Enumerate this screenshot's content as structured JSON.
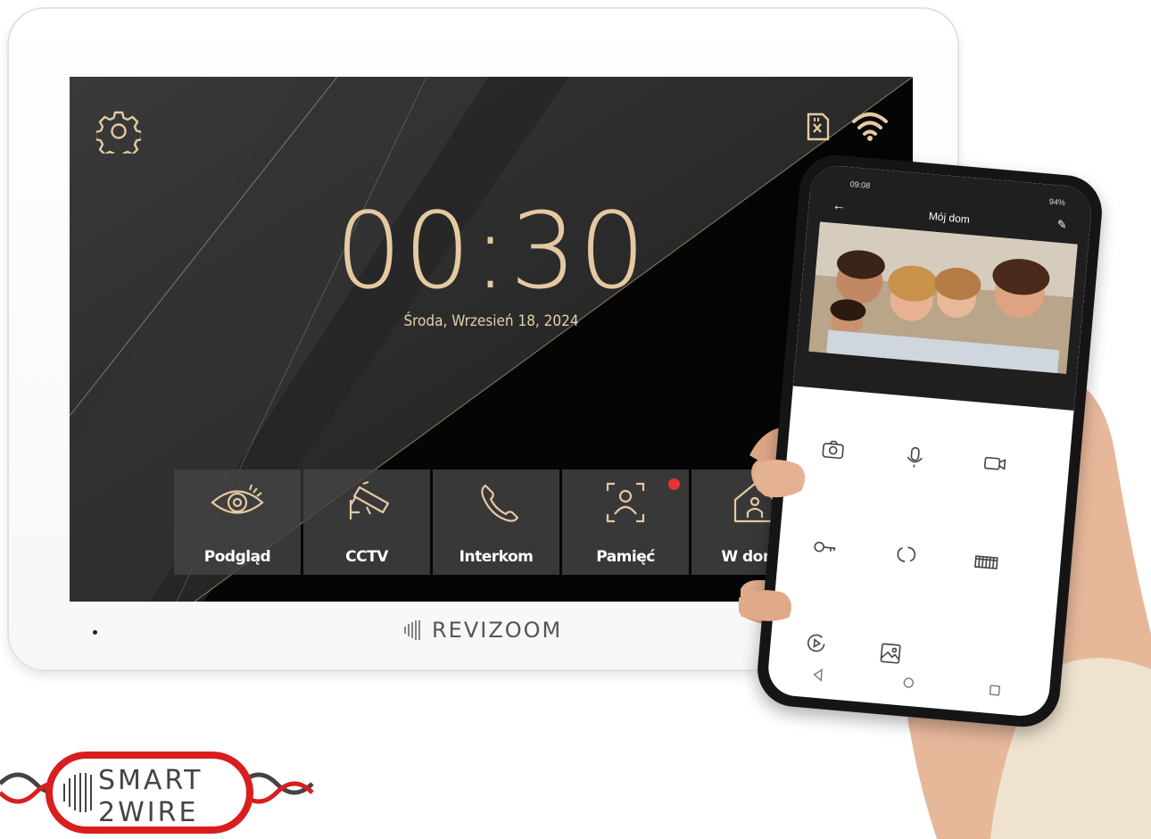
{
  "monitor": {
    "time": "00:30",
    "date": "Środa, Wrzesień 18, 2024",
    "status_icons": [
      "sd-card-icon",
      "wifi-icon"
    ],
    "settings_icon": "gear-icon",
    "tiles": [
      {
        "label": "Podgląd",
        "icon": "eye-icon"
      },
      {
        "label": "CCTV",
        "icon": "cctv-camera-icon"
      },
      {
        "label": "Interkom",
        "icon": "phone-handset-icon"
      },
      {
        "label": "Pamięć",
        "icon": "face-scan-icon",
        "badge": true
      },
      {
        "label": "W domu",
        "icon": "home-person-icon"
      }
    ],
    "brand": "REVIZOOM",
    "accent_color": "#e5c9a1"
  },
  "phone": {
    "status_time": "09:08",
    "status_right": "94%",
    "title": "Mój dom",
    "controls": [
      "camera-icon",
      "microphone-icon",
      "video-record-icon",
      "key-icon",
      "rotate-icon",
      "gate-icon",
      "playback-icon",
      "gallery-icon"
    ]
  },
  "logo": {
    "line1": "SMART",
    "line2": "2WIRE"
  }
}
